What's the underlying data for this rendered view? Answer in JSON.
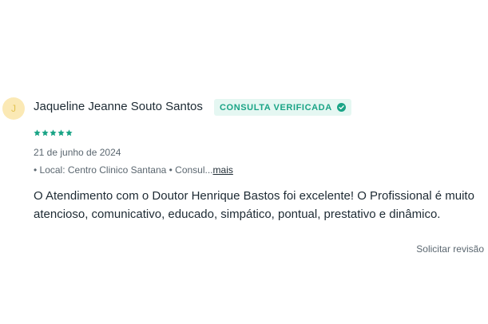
{
  "review": {
    "avatar_initial": "J",
    "reviewer_name": "Jaqueline Jeanne Souto Santos",
    "badge_label": "CONSULTA VERIFICADA",
    "rating": 5,
    "rating_max": 5,
    "date": "21 de junho de 2024",
    "location_prefix": "• Local: Centro Clinico Santana • Consul...",
    "more_label": "mais",
    "comment": "O Atendimento com o Doutor Henrique Bastos foi excelente! O Profissional é muito atencioso, comunicativo, educado, simpático, pontual, prestativo e dinâmico.",
    "request_revision_label": "Solicitar revisão"
  },
  "colors": {
    "accent": "#1aa486",
    "badge_background": "#e5f7f2",
    "avatar_background": "#fbe9b5",
    "star": "#1aa486"
  },
  "icons": {
    "badge_icon": "check-circle-icon",
    "rating_icon": "star-icon"
  }
}
